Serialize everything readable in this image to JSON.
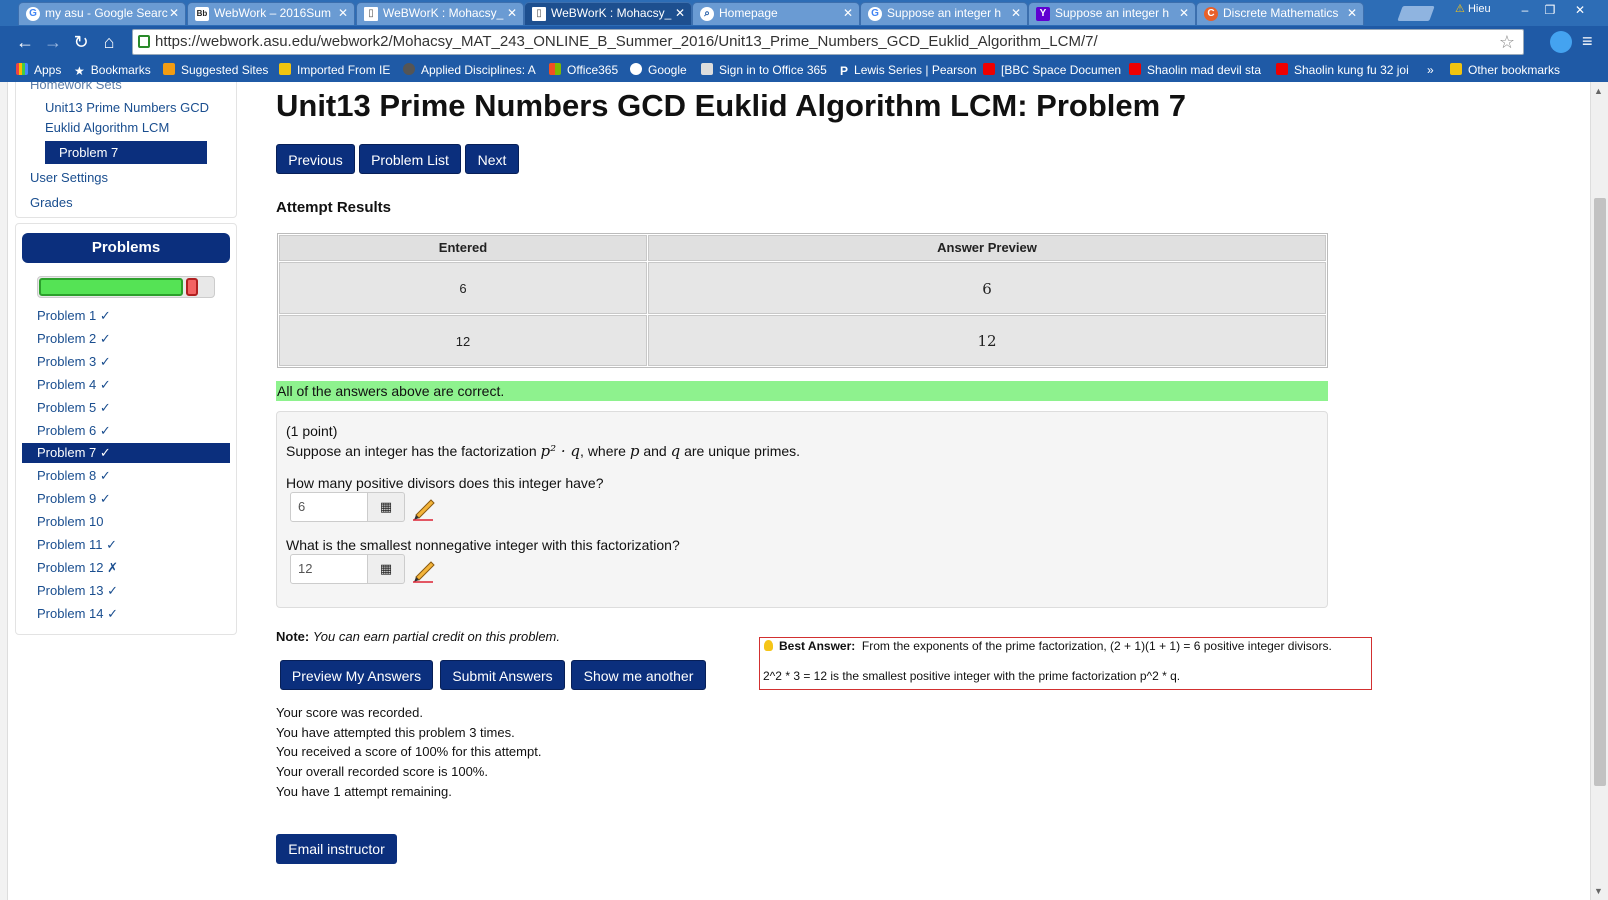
{
  "browser": {
    "tabs": [
      {
        "title": "my asu - Google Searc",
        "icon": "G"
      },
      {
        "title": "WebWork – 2016Sum",
        "icon": "Bb"
      },
      {
        "title": "WeBWorK : Mohacsy_",
        "icon": "doc"
      },
      {
        "title": "WeBWorK : Mohacsy_",
        "icon": "doc"
      },
      {
        "title": "Homepage",
        "icon": "search"
      },
      {
        "title": "Suppose an integer h",
        "icon": "G"
      },
      {
        "title": "Suppose an integer h",
        "icon": "Y"
      },
      {
        "title": "Discrete Mathematics",
        "icon": "C"
      }
    ],
    "profile_name": "Hieu",
    "url": "https://webwork.asu.edu/webwork2/Mohacsy_MAT_243_ONLINE_B_Summer_2016/Unit13_Prime_Numbers_GCD_Euklid_Algorithm_LCM/7/",
    "bookmarks": [
      "Apps",
      "Bookmarks",
      "Suggested Sites",
      "Imported From IE",
      "Applied Disciplines: A",
      "Office365",
      "Google",
      "Sign in to Office 365",
      "Lewis Series | Pearson",
      "[BBC Space Documen",
      "Shaolin mad devil sta",
      "Shaolin kung fu 32 joi",
      "»",
      "Other bookmarks"
    ]
  },
  "sidebar": {
    "homework_sets_label": "Homework Sets",
    "set_name_line1": "Unit13 Prime Numbers GCD",
    "set_name_line2": "Euklid Algorithm LCM",
    "current_problem": "Problem 7",
    "user_settings": "User Settings",
    "grades": "Grades",
    "problems_header": "Problems",
    "progress_correct_fraction": 0.92,
    "problems": [
      "Problem 1 ✓",
      "Problem 2 ✓",
      "Problem 3 ✓",
      "Problem 4 ✓",
      "Problem 5 ✓",
      "Problem 6 ✓",
      "Problem 7 ✓",
      "Problem 8 ✓",
      "Problem 9 ✓",
      "Problem 10",
      "Problem 11 ✓",
      "Problem 12 ✗",
      "Problem 13 ✓",
      "Problem 14 ✓"
    ],
    "active_index": 6
  },
  "main": {
    "title": "Unit13 Prime Numbers GCD Euklid Algorithm LCM: Problem 7",
    "nav": {
      "previous": "Previous",
      "problem_list": "Problem List",
      "next": "Next"
    },
    "attempt_heading": "Attempt Results",
    "table": {
      "headers": [
        "Entered",
        "Answer Preview"
      ],
      "rows": [
        [
          "6",
          "6"
        ],
        [
          "12",
          "12"
        ]
      ]
    },
    "correct_message": "All of the answers above are correct.",
    "problem": {
      "points": "(1 point)",
      "stmt_a": "Suppose an integer has the factorization ",
      "stmt_math": "p² · q",
      "stmt_b": ", where ",
      "var_p": "p",
      "stmt_c": " and ",
      "var_q": "q",
      "stmt_d": " are unique primes.",
      "q1": "How many positive divisors does this integer have?",
      "a1": "6",
      "q2": "What is the smallest nonnegative integer with this factorization?",
      "a2": "12"
    },
    "note_label": "Note:",
    "note_text": "You can earn partial credit on this problem.",
    "actions": {
      "preview": "Preview My Answers",
      "submit": "Submit Answers",
      "another": "Show me another"
    },
    "status": [
      "Your score was recorded.",
      "You have attempted this problem 3 times.",
      "You received a score of 100% for this attempt.",
      "Your overall recorded score is 100%.",
      "You have 1 attempt remaining."
    ],
    "email_instructor": "Email instructor"
  },
  "best_answer": {
    "label": "Best Answer:",
    "line1": "From the exponents of the prime factorization, (2 + 1)(1 + 1) = 6 positive integer divisors.",
    "line2": "2^2 * 3 = 12 is the smallest positive integer with the prime factorization p^2 * q."
  },
  "colors": {
    "nav_blue": "#0b2f7d",
    "correct_green": "#8ef28e",
    "chrome_blue": "#1f5aa6"
  }
}
